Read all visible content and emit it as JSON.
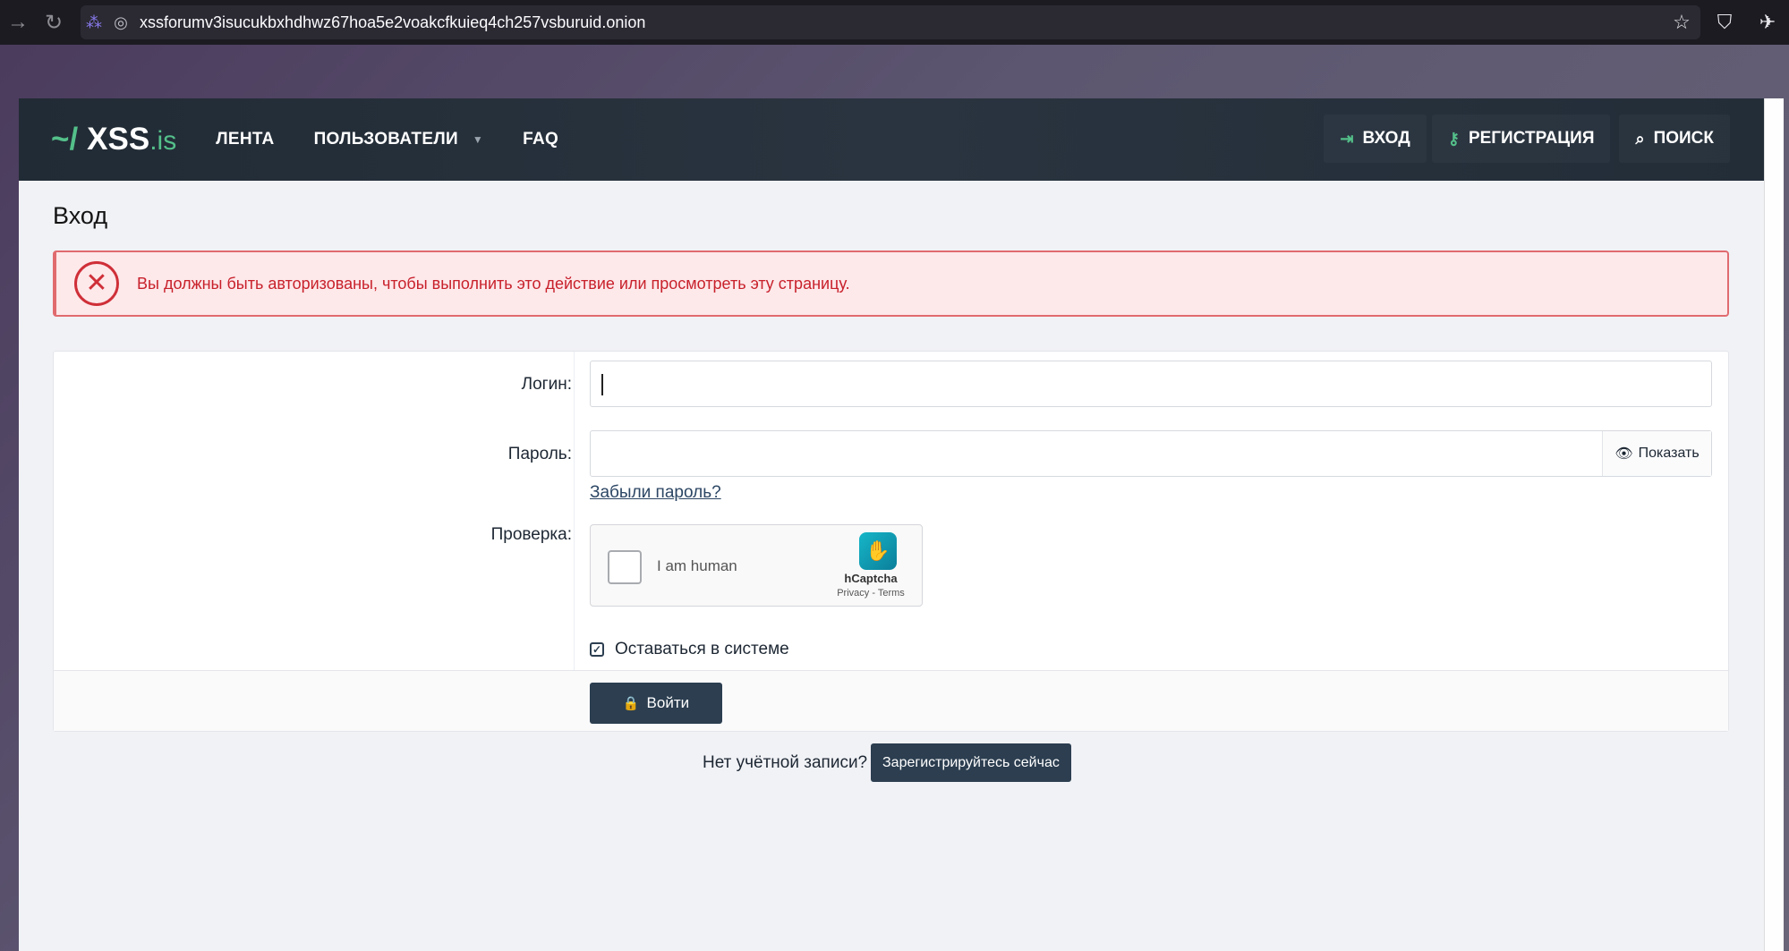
{
  "browser": {
    "url": "xssforumv3isucukbxhdhwz67hoa5e2voakcfkuieq4ch257vsburuid.onion",
    "icons": [
      "forward-icon",
      "reload-icon",
      "tor-circuit-icon",
      "onion-lock-icon",
      "bookmark-star-icon",
      "shield-icon",
      "extensions-icon"
    ]
  },
  "header": {
    "logo_prefix": "~/",
    "logo_main": "XSS",
    "logo_suffix": ".is",
    "nav": [
      "ЛЕНТА",
      "ПОЛЬЗОВАТЕЛИ",
      "FAQ"
    ],
    "login": "ВХОД",
    "register": "РЕГИСТРАЦИЯ",
    "search": "ПОИСК",
    "accent_color": "#54c08a"
  },
  "page": {
    "title": "Вход",
    "alert": "Вы должны быть авторизованы, чтобы выполнить это действие или просмотреть эту страницу."
  },
  "form": {
    "login_label": "Логин:",
    "login_value": "",
    "password_label": "Пароль:",
    "password_value": "",
    "show_label": "Показать",
    "forgot": "Забыли пароль?",
    "verify_label": "Проверка:",
    "captcha": {
      "text": "I am human",
      "brand": "hCaptcha",
      "links": "Privacy - Terms"
    },
    "stay_logged": "Оставаться в системе",
    "stay_checked": true,
    "submit": "Войти"
  },
  "footer": {
    "no_account": "Нет учётной записи?",
    "register_now": "Зарегистрируйтесь сейчас"
  }
}
